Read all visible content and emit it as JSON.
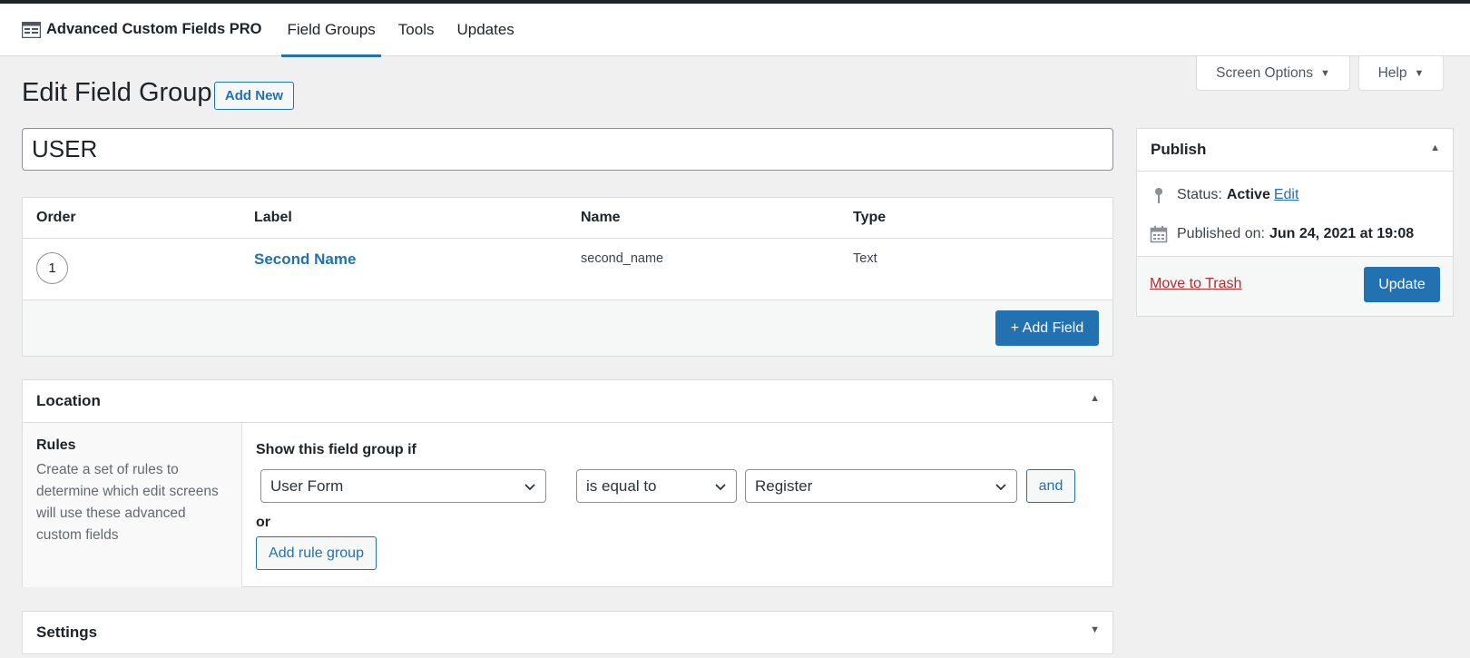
{
  "header": {
    "brand_title": "Advanced Custom Fields PRO",
    "tabs": [
      {
        "label": "Field Groups",
        "active": true
      },
      {
        "label": "Tools",
        "active": false
      },
      {
        "label": "Updates",
        "active": false
      }
    ]
  },
  "screen_meta": {
    "screen_options_label": "Screen Options",
    "help_label": "Help"
  },
  "page": {
    "title": "Edit Field Group",
    "add_new_label": "Add New",
    "group_title_value": "USER"
  },
  "fields_table": {
    "columns": [
      "Order",
      "Label",
      "Name",
      "Type"
    ],
    "rows": [
      {
        "order": "1",
        "label": "Second Name",
        "name": "second_name",
        "type": "Text"
      }
    ],
    "add_field_label": "+ Add Field"
  },
  "location": {
    "title": "Location",
    "rules_label": "Rules",
    "rules_description": "Create a set of rules to determine which edit screens will use these advanced custom fields",
    "show_if_label": "Show this field group if",
    "rule": {
      "param": "User Form",
      "operator": "is equal to",
      "value": "Register"
    },
    "and_label": "and",
    "or_label": "or",
    "add_rule_group_label": "Add rule group"
  },
  "settings": {
    "title": "Settings"
  },
  "publish": {
    "title": "Publish",
    "status_label": "Status:",
    "status_value": "Active",
    "status_edit_label": "Edit",
    "published_label": "Published on:",
    "published_value": "Jun 24, 2021 at 19:08",
    "trash_label": "Move to Trash",
    "update_label": "Update"
  },
  "colors": {
    "accent": "#2271b1",
    "danger": "#b32d2e",
    "background": "#f0f0f1"
  },
  "icons": [
    "acf-logo-icon",
    "caret-down-icon",
    "collapse-up-icon",
    "collapse-down-icon",
    "chevron-down-icon",
    "pin-icon",
    "calendar-icon"
  ]
}
